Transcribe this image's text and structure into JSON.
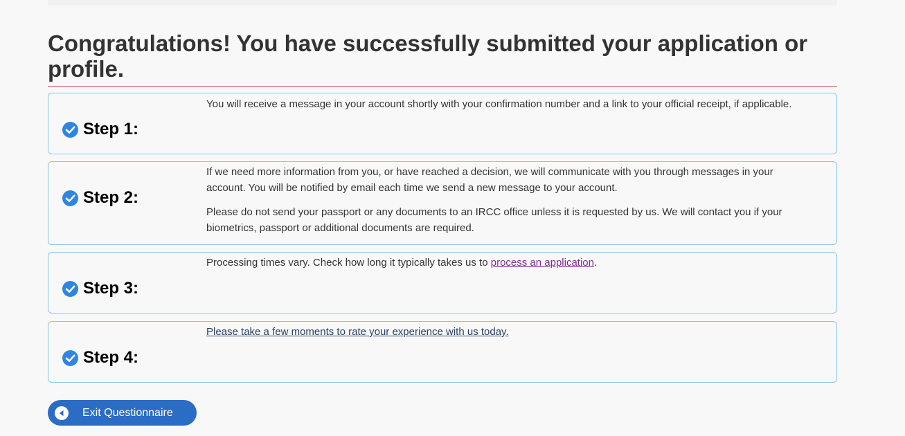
{
  "page": {
    "title": "Congratulations! You have successfully submitted your application or profile."
  },
  "steps": [
    {
      "label": "Step 1:",
      "paragraphs": [
        "You will receive a message in your account shortly with your confirmation number and a link to your official receipt, if applicable."
      ]
    },
    {
      "label": "Step 2:",
      "paragraphs": [
        "If we need more information from you, or have reached a decision, we will communicate with you through messages in your account. You will be notified by email each time we send a new message to your account.",
        "Please do not send your passport or any documents to an IRCC office unless it is requested by us. We will contact you if your biometrics, passport or additional documents are required."
      ]
    },
    {
      "label": "Step 3:",
      "text_before": "Processing times vary. Check how long it typically takes us to ",
      "link": "process an application",
      "text_after": "."
    },
    {
      "label": "Step 4:",
      "link": "Please take a few moments to rate your experience with us today."
    }
  ],
  "exit_button": {
    "label": "Exit Questionnaire",
    "icon": "back-arrow-circle-icon"
  },
  "colors": {
    "accent": "#2b6cc4",
    "check": "#2e86e0",
    "rule": "#af3c43",
    "border": "#8dc6e8",
    "visited_link": "#7b2d8f"
  }
}
